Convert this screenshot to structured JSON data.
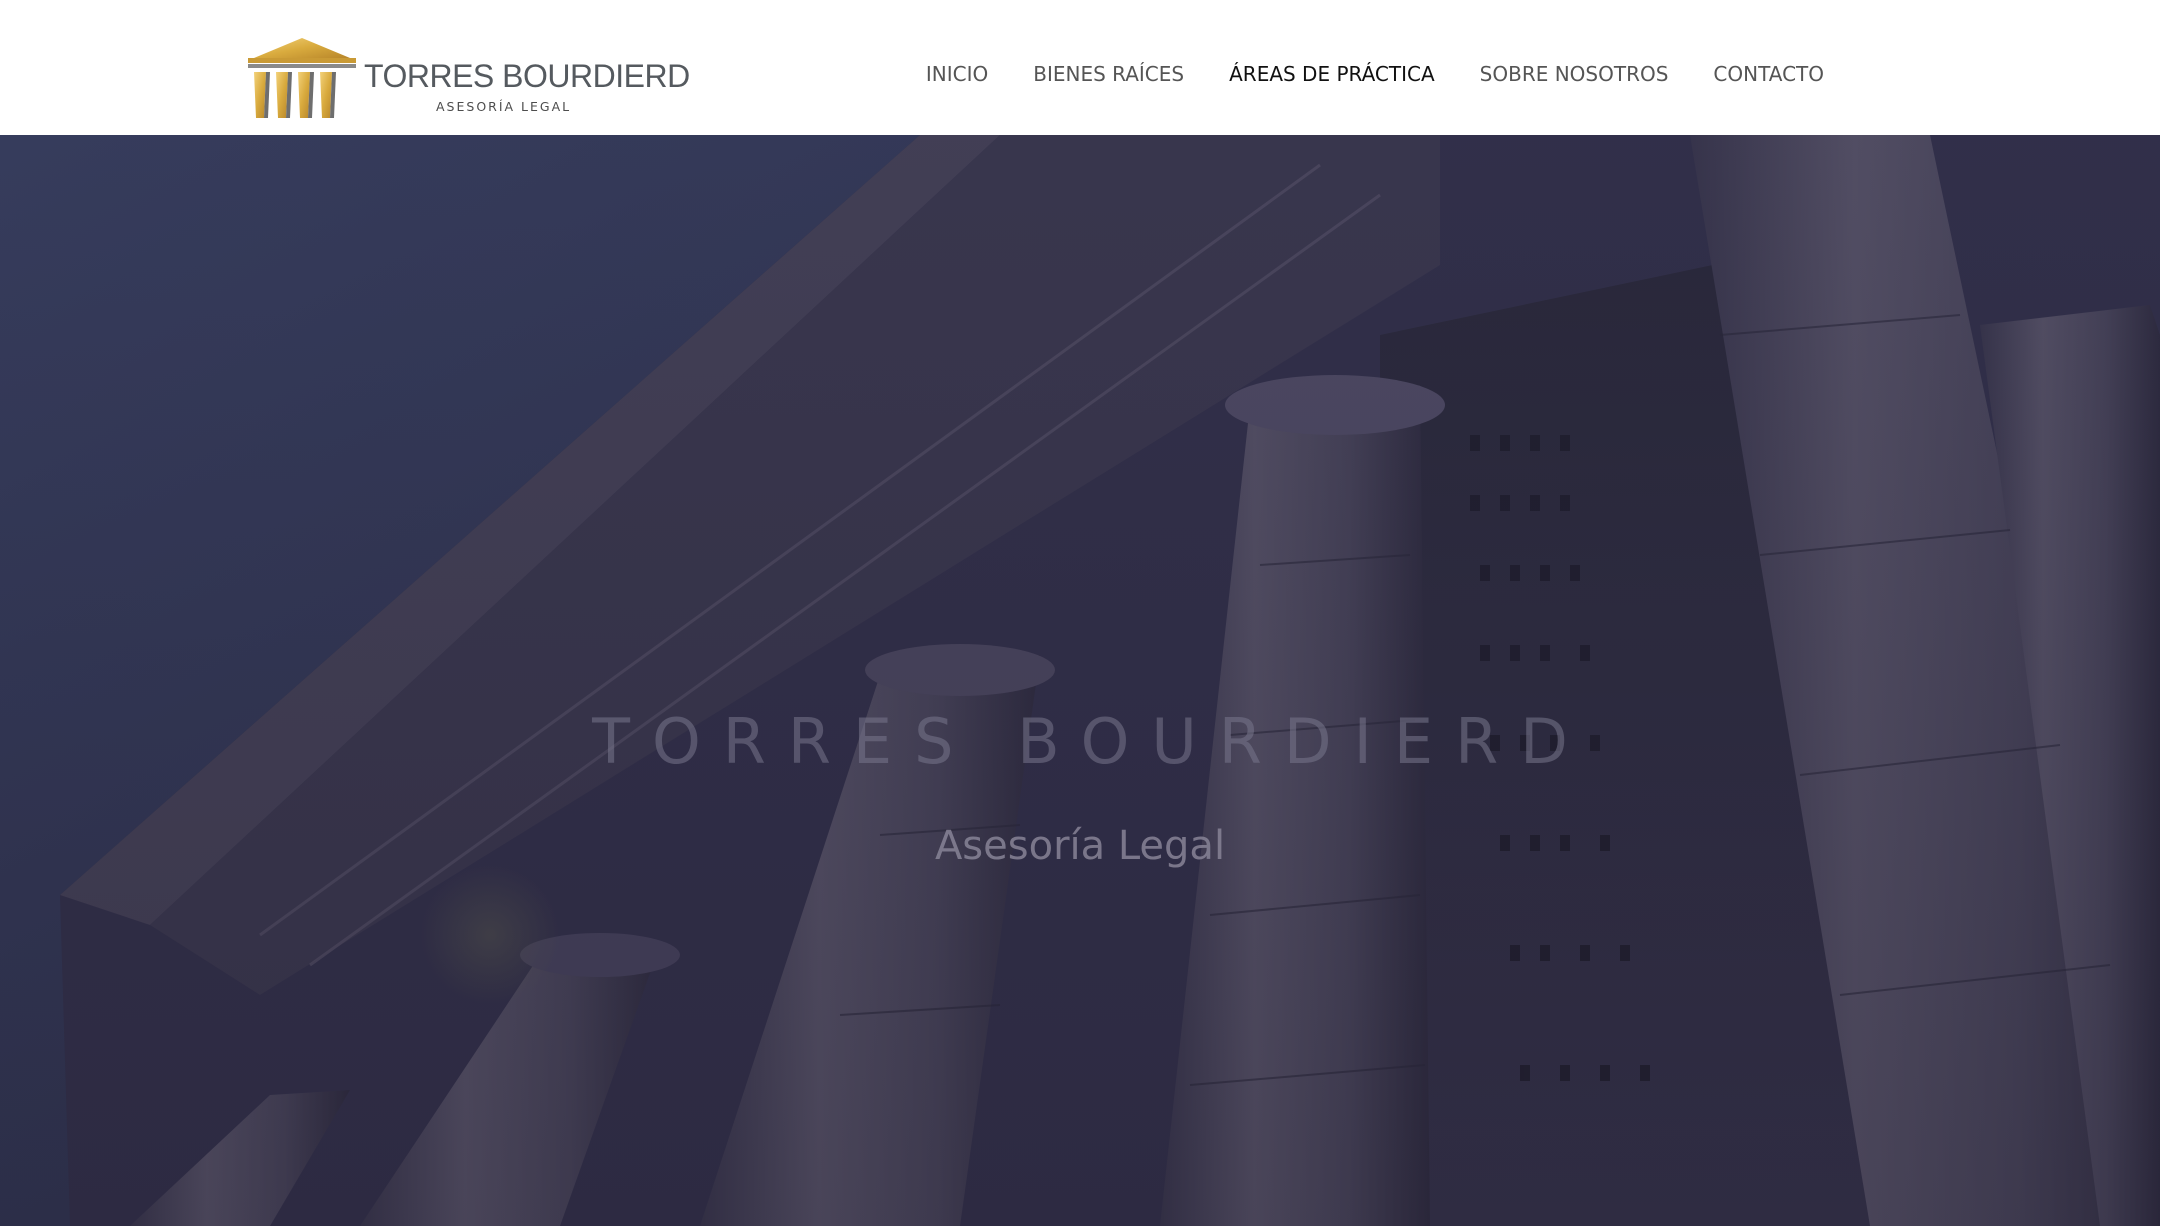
{
  "brand": {
    "name": "TORRES BOURDIERD",
    "tagline": "ASESORÍA LEGAL",
    "logo_icon": "temple-columns-icon",
    "gold": "#d9b04a"
  },
  "nav": {
    "items": [
      {
        "label": "INICIO"
      },
      {
        "label": "BIENES RAÍCES"
      },
      {
        "label": "ÁREAS DE PRÁCTICA",
        "active": true
      },
      {
        "label": "SOBRE NOSOTROS"
      },
      {
        "label": "CONTACTO"
      }
    ]
  },
  "hero": {
    "title": "TORRES BOURDIERD",
    "subtitle": "Asesoría Legal",
    "background_image": "building-columns-image",
    "tint": "#2c2e48"
  }
}
